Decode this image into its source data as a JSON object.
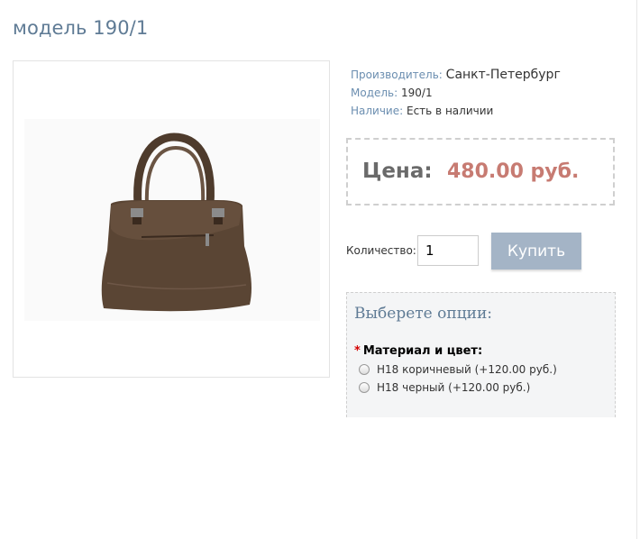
{
  "product": {
    "title": "модель 190/1",
    "image_alt": "коричневая сумка"
  },
  "details": {
    "manufacturer_label": "Производитель:",
    "manufacturer_value": "Санкт-Петербург",
    "model_label": "Модель:",
    "model_value": "190/1",
    "availability_label": "Наличие:",
    "availability_value": "Есть в наличии"
  },
  "price": {
    "label": "Цена:",
    "value": "480.00 руб."
  },
  "purchase": {
    "quantity_label": "Количество:",
    "quantity_value": "1",
    "buy_label": "Купить"
  },
  "options": {
    "title": "Выберете опции:",
    "required_mark": "*",
    "material_label": "Материал и цвет:",
    "choices": [
      {
        "label": "Н18 коричневый (+120.00 руб.)"
      },
      {
        "label": "Н18 черный (+120.00 руб.)"
      }
    ]
  },
  "colors": {
    "title": "#5f7b95",
    "price": "#c77b72",
    "button": "#a4b4c6",
    "link_label": "#6b8eb0",
    "bag": "#5a4534"
  }
}
